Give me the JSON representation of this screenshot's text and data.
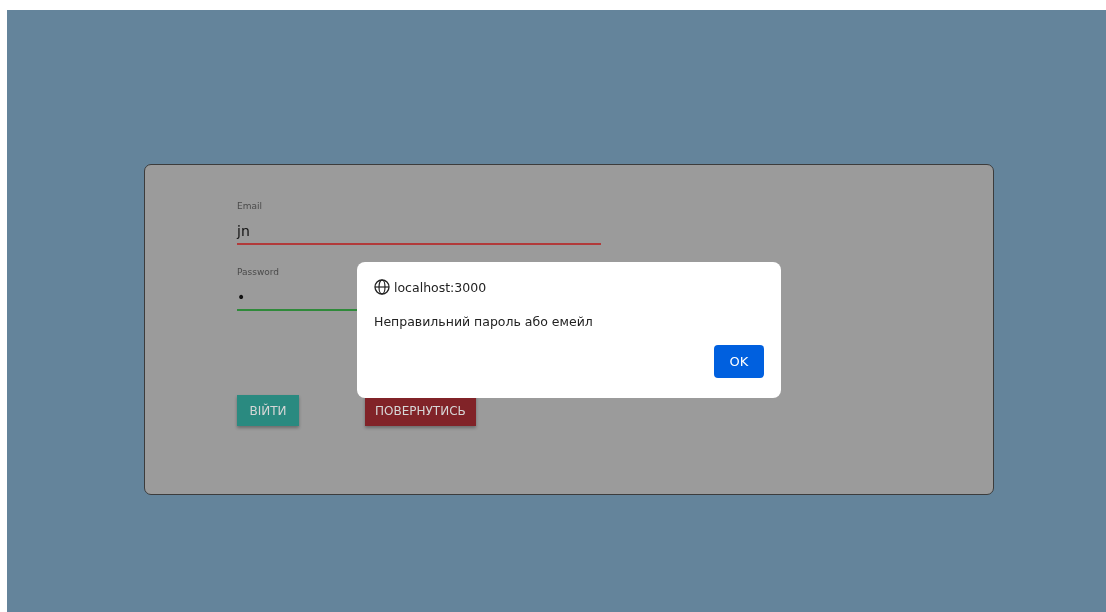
{
  "form": {
    "fields": [
      {
        "label": "Email",
        "value": "jn",
        "valid": false
      },
      {
        "label": "Password",
        "value": "•",
        "valid": true
      }
    ],
    "buttons": [
      {
        "label": "ВІЙТИ",
        "kind": "primary"
      },
      {
        "label": "ПОВЕРНУТИСЬ",
        "kind": "danger"
      }
    ]
  },
  "dialog": {
    "origin": "localhost:3000",
    "message": "Неправильний пароль або емейл",
    "button": "OK"
  }
}
